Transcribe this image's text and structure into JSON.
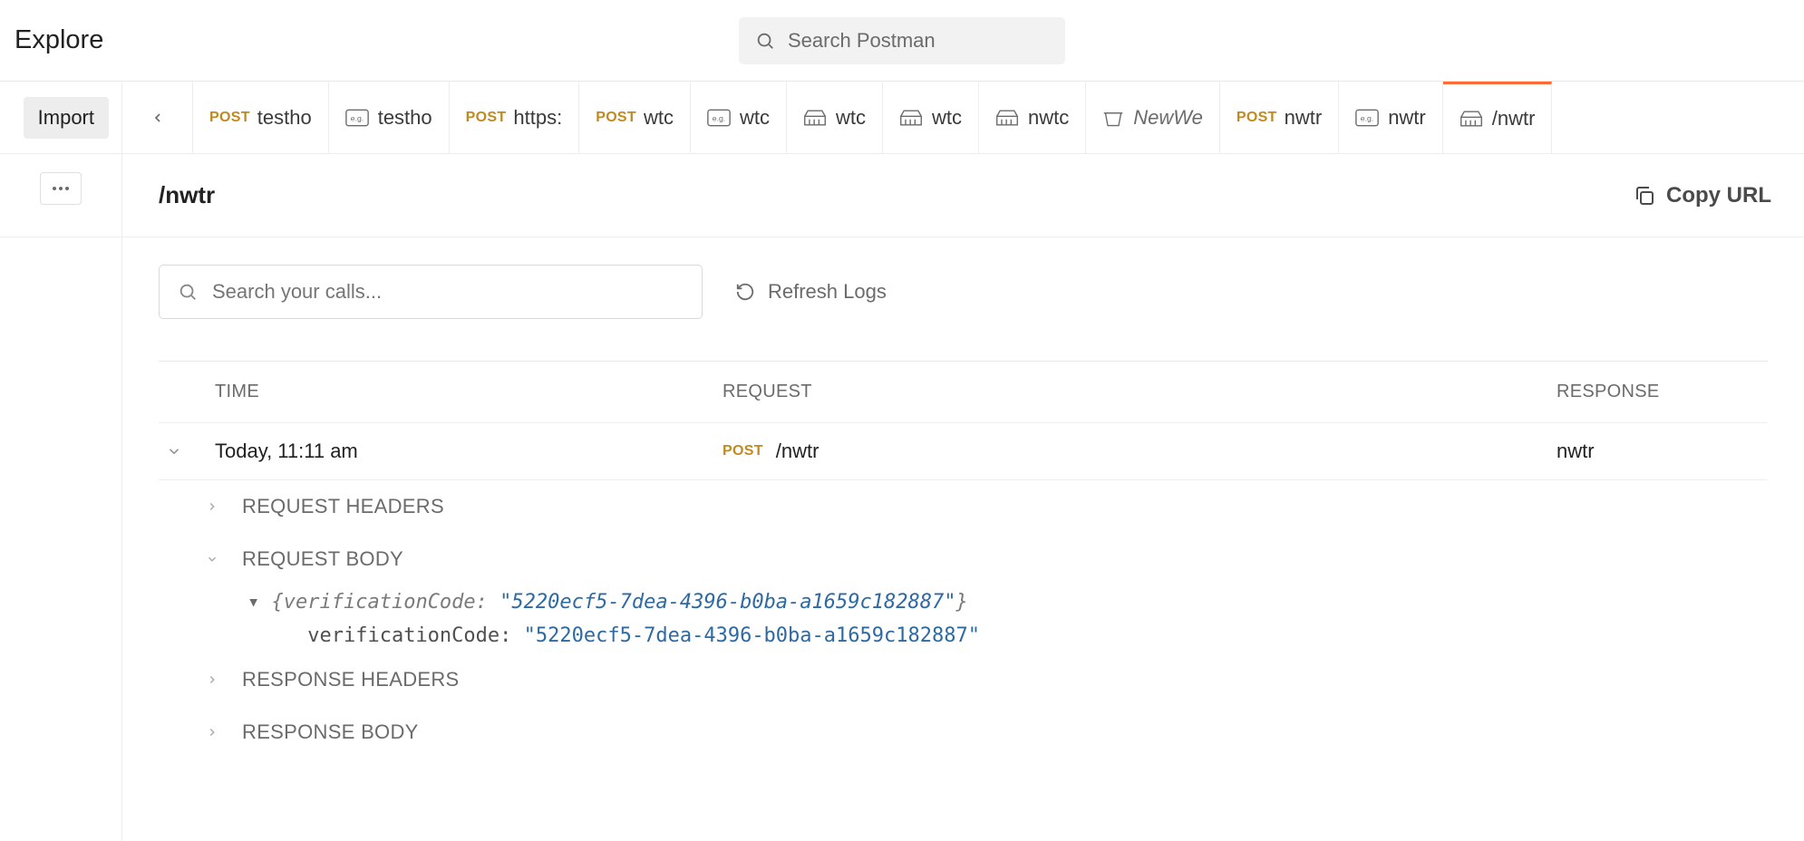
{
  "header": {
    "explore": "Explore",
    "search_placeholder": "Search Postman"
  },
  "toolbar_top": {
    "import": "Import"
  },
  "tabs": [
    {
      "kind": "post",
      "label": "testho"
    },
    {
      "kind": "example",
      "label": "testho"
    },
    {
      "kind": "post",
      "label": "https:"
    },
    {
      "kind": "post",
      "label": "wtc"
    },
    {
      "kind": "example",
      "label": "wtc"
    },
    {
      "kind": "mock",
      "label": "wtc"
    },
    {
      "kind": "mock",
      "label": "wtc"
    },
    {
      "kind": "mock",
      "label": "nwtc"
    },
    {
      "kind": "ws",
      "label": "NewWe",
      "italic": true
    },
    {
      "kind": "post",
      "label": "nwtr"
    },
    {
      "kind": "example",
      "label": "nwtr"
    },
    {
      "kind": "mock",
      "label": "/nwtr",
      "active": true
    }
  ],
  "page": {
    "title": "/nwtr",
    "copy_url": "Copy URL"
  },
  "calls": {
    "search_placeholder": "Search your calls...",
    "refresh": "Refresh Logs",
    "columns": {
      "time": "TIME",
      "request": "REQUEST",
      "response": "RESPONSE"
    },
    "row": {
      "time": "Today, 11:11 am",
      "method": "POST",
      "path": "/nwtr",
      "response": "nwtr"
    },
    "sections": {
      "req_headers": "REQUEST HEADERS",
      "req_body": "REQUEST BODY",
      "res_headers": "RESPONSE HEADERS",
      "res_body": "RESPONSE BODY"
    },
    "body_json": {
      "summary_key": "verificationCode",
      "summary_val": "\"5220ecf5-7dea-4396-b0ba-a1659c182887\"",
      "expanded_key": "verificationCode",
      "expanded_val": "\"5220ecf5-7dea-4396-b0ba-a1659c182887\""
    }
  },
  "glyphs": {
    "method_post": "POST"
  }
}
